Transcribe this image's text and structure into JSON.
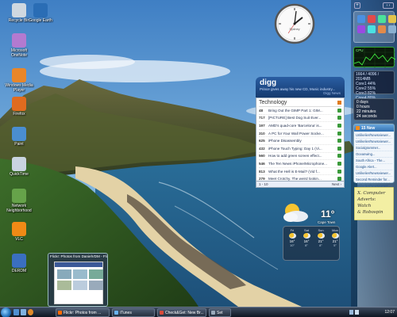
{
  "desktop_icons": [
    {
      "label": "Recycle Bin",
      "color": "#cfd8e0"
    },
    {
      "label": "Google Earth",
      "color": "#2a6db5"
    },
    {
      "label": "Microsoft OneNote",
      "color": "#b37ad0"
    },
    {
      "label": "Windows Media Player",
      "color": "#e8862a"
    },
    {
      "label": "Firefox",
      "color": "#e06b1f"
    },
    {
      "label": "Paint",
      "color": "#4a8ed0"
    },
    {
      "label": "QuickTime",
      "color": "#c9d4e0"
    },
    {
      "label": "Network Neighborhood",
      "color": "#66a34a"
    },
    {
      "label": "VLC",
      "color": "#f08a16"
    },
    {
      "label": "DERDM",
      "color": "#3a6fc0"
    }
  ],
  "clock": {
    "brand": "Sydney"
  },
  "sidebar": {
    "cpu_label": "CPU",
    "mem_lines": [
      "1664 / 4096 / 2014MB",
      "Core1  44%",
      "Core2  55%",
      "Core3  82%",
      "Core4  80%"
    ],
    "countdown": [
      "0 days",
      "0 hours",
      "22 minutes",
      "24 seconds"
    ],
    "news_title": "15 New",
    "news_items": [
      "Unlikelier/Newsviewer...",
      "Unlikelier/Newsviewer...",
      "Socialgrammer...",
      "Oceanwing...",
      "South Africa - The...",
      "Google Alert...",
      "Unlikelier/Newsviewer...",
      "Second Reminder for...",
      "Unlikelier/Newsviewer..."
    ],
    "note_lines": [
      "X. Computer",
      "Adverts: Watch",
      "& Robospin"
    ]
  },
  "digg": {
    "logo": "digg",
    "headline": "Prince gives away his new CD, Music industry...",
    "subtitle": "Digg News",
    "category": "Technology",
    "stories": [
      {
        "n": "48",
        "t": "Bring Out the GIMP Part 1: GIM..."
      },
      {
        "n": "717",
        "t": "[PICTURE] Best Dog Suit Ever..."
      },
      {
        "n": "197",
        "t": "AMD's quad-core 'Barcelona' is..."
      },
      {
        "n": "310",
        "t": "A PC for Your Wall Power Socke..."
      },
      {
        "n": "625",
        "t": "iPhone Disassembly"
      },
      {
        "n": "432",
        "t": "iPhone Touch Typing: Day 1 (Vi..."
      },
      {
        "n": "560",
        "t": "How to add green screen effect..."
      },
      {
        "n": "546",
        "t": "The Ten News iPhone/Microphone..."
      },
      {
        "n": "813",
        "t": "What the Hell is E-Mail? (Vid f..."
      },
      {
        "n": "279",
        "t": "Meet Crotchy. The weird lookin..."
      }
    ],
    "page": "1 - 10",
    "next": "Next ›"
  },
  "weather": {
    "temp": "11°",
    "place": "Cape Town",
    "days": [
      {
        "name": "Fri",
        "hi": "16°",
        "lo": "10°"
      },
      {
        "name": "Sat",
        "hi": "16°",
        "lo": "8°"
      },
      {
        "name": "Sun",
        "hi": "21°",
        "lo": "8°"
      },
      {
        "name": "Mon",
        "hi": "21°",
        "lo": "5°"
      }
    ]
  },
  "thumbnail": {
    "title": "Flickr: Photos from DanielVDM - Flock"
  },
  "taskbar": {
    "buttons": [
      {
        "label": "Flickr: Photos from ...",
        "color": "#ff6a00"
      },
      {
        "label": "iTunes",
        "color": "#6bb3f0"
      },
      {
        "label": "Check&Get: New Br...",
        "color": "#d84a3a"
      },
      {
        "label": "Set",
        "color": "#9aaabb"
      }
    ],
    "time": "12:07"
  }
}
